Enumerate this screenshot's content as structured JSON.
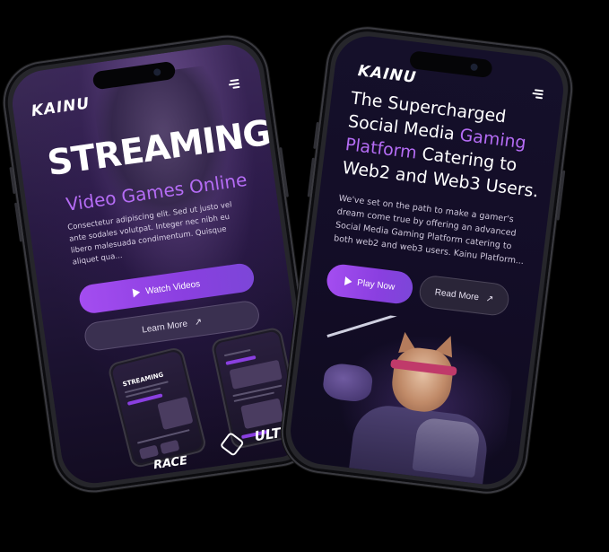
{
  "left_phone": {
    "logo": "KAINU",
    "hero_title": "STREAMING",
    "hero_subtitle": "Video Games Online",
    "hero_text": "Consectetur adipiscing elit. Sed ut justo vel ante sodales volutpat. Integer nec nibh eu libero malesuada condimentum. Quisque aliquet qua...",
    "watch_button": "Watch Videos",
    "learn_button": "Learn More",
    "mini_a_title": "STREAMING",
    "brands": {
      "race": "RACE",
      "ultrex": "ULTREX"
    }
  },
  "right_phone": {
    "logo": "KAINU",
    "title_part1": "The Supercharged Social Media ",
    "title_accent": "Gaming Platform",
    "title_part2": " Catering to Web2 and Web3 Users.",
    "body": "We've set on the path to make a gamer's dream come true by offering an advanced Social Media Gaming Platform catering to both web2 and web3 users. Kainu Platform...",
    "play_button": "Play Now",
    "read_button": "Read More"
  },
  "colors": {
    "accent": "#b56cf5",
    "button_gradient_start": "#a44df0",
    "background": "#000000"
  },
  "icons": [
    "menu-icon",
    "play-icon",
    "arrow-up-right-icon"
  ]
}
